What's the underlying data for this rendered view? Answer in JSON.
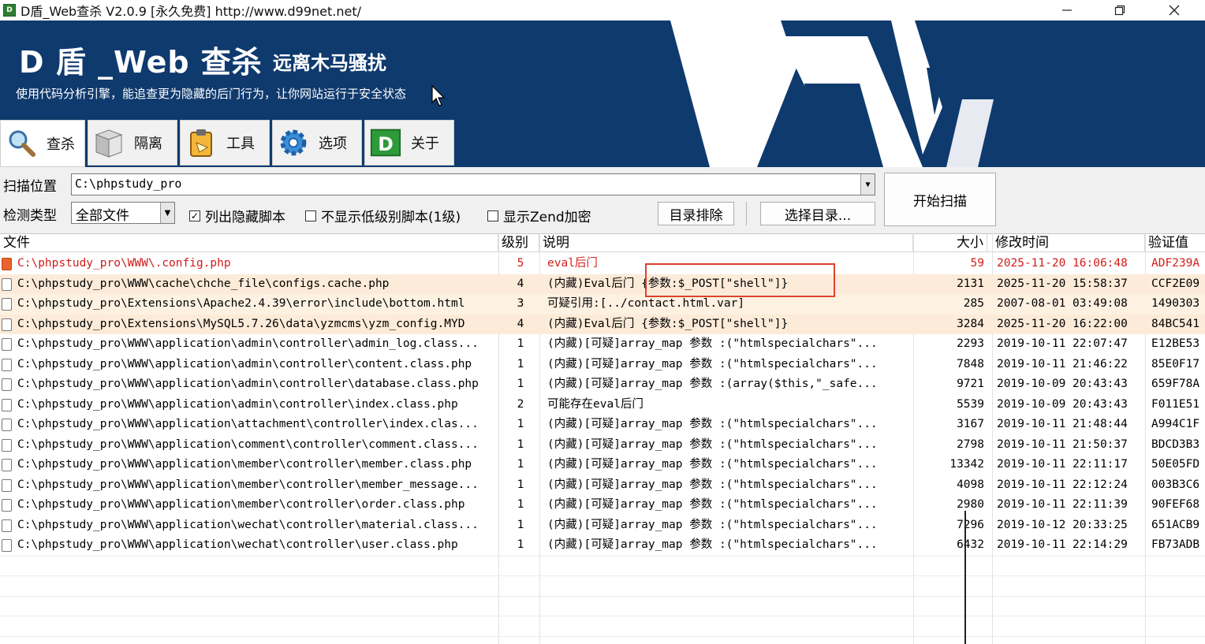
{
  "window": {
    "title": "D盾_Web查杀 V2.0.9 [永久免费] http://www.d99net.net/",
    "icon_label": "D",
    "controls": [
      "minimize-icon",
      "restore-icon",
      "close-icon"
    ]
  },
  "banner": {
    "title": "D 盾 _Web 查杀",
    "subtitle": "远离木马骚扰",
    "description": "使用代码分析引擎，能追查更为隐藏的后门行为，让你网站运行于安全状态",
    "background_color": "#0f3a6e"
  },
  "tabs": [
    {
      "label": "查杀",
      "icon": "magnifier-icon",
      "active": true
    },
    {
      "label": "隔离",
      "icon": "box-icon",
      "active": false
    },
    {
      "label": "工具",
      "icon": "clipboard-icon",
      "active": false
    },
    {
      "label": "选项",
      "icon": "gear-icon",
      "active": false
    },
    {
      "label": "关于",
      "icon": "d-logo-icon",
      "active": false
    }
  ],
  "controls": {
    "scan_location_label": "扫描位置",
    "scan_location_value": "C:\\phpstudy_pro",
    "detect_type_label": "检测类型",
    "detect_type_value": "全部文件",
    "show_hidden": {
      "label": "列出隐藏脚本",
      "checked": true
    },
    "hide_low_level": {
      "label": "不显示低级别脚本(1级)",
      "checked": false
    },
    "show_zend": {
      "label": "显示Zend加密",
      "checked": false
    },
    "exclude_dir_button": "目录排除",
    "select_dir_button": "选择目录...",
    "start_scan_button": "开始扫描"
  },
  "table": {
    "headers": {
      "file": "文件",
      "level": "级别",
      "desc": "说明",
      "size": "大小",
      "mtime": "修改时间",
      "hash": "验证值"
    },
    "rows": [
      {
        "file": "C:\\phpstudy_pro\\WWW\\.config.php",
        "level": "5",
        "desc": "eval后门",
        "size": "59",
        "mtime": "2025-11-20 16:06:48",
        "hash": "ADF239A",
        "style": "red"
      },
      {
        "file": "C:\\phpstudy_pro\\WWW\\cache\\chche_file\\configs.cache.php",
        "level": "4",
        "desc": "(内藏)Eval后门 {参数:$_POST[\"shell\"]}",
        "size": "2131",
        "mtime": "2025-11-20 15:58:37",
        "hash": "CCF2E09",
        "style": "hl"
      },
      {
        "file": "C:\\phpstudy_pro\\Extensions\\Apache2.4.39\\error\\include\\bottom.html",
        "level": "3",
        "desc": "可疑引用:[../contact.html.var]",
        "size": "285",
        "mtime": "2007-08-01 03:49:08",
        "hash": "1490303",
        "style": "sel"
      },
      {
        "file": "C:\\phpstudy_pro\\Extensions\\MySQL5.7.26\\data\\yzmcms\\yzm_config.MYD",
        "level": "4",
        "desc": "(内藏)Eval后门 {参数:$_POST[\"shell\"]}",
        "size": "3284",
        "mtime": "2025-11-20 16:22:00",
        "hash": "84BC541",
        "style": "hl"
      },
      {
        "file": "C:\\phpstudy_pro\\WWW\\application\\admin\\controller\\admin_log.class...",
        "level": "1",
        "desc": "(内藏)[可疑]array_map 参数 :(\"htmlspecialchars\"...",
        "size": "2293",
        "mtime": "2019-10-11 22:07:47",
        "hash": "E12BE53",
        "style": ""
      },
      {
        "file": "C:\\phpstudy_pro\\WWW\\application\\admin\\controller\\content.class.php",
        "level": "1",
        "desc": "(内藏)[可疑]array_map 参数 :(\"htmlspecialchars\"...",
        "size": "7848",
        "mtime": "2019-10-11 21:46:22",
        "hash": "85E0F17",
        "style": ""
      },
      {
        "file": "C:\\phpstudy_pro\\WWW\\application\\admin\\controller\\database.class.php",
        "level": "1",
        "desc": "(内藏)[可疑]array_map 参数 :(array($this,\"_safe...",
        "size": "9721",
        "mtime": "2019-10-09 20:43:43",
        "hash": "659F78A",
        "style": ""
      },
      {
        "file": "C:\\phpstudy_pro\\WWW\\application\\admin\\controller\\index.class.php",
        "level": "2",
        "desc": "可能存在eval后门",
        "size": "5539",
        "mtime": "2019-10-09 20:43:43",
        "hash": "F011E51",
        "style": ""
      },
      {
        "file": "C:\\phpstudy_pro\\WWW\\application\\attachment\\controller\\index.clas...",
        "level": "1",
        "desc": "(内藏)[可疑]array_map 参数 :(\"htmlspecialchars\"...",
        "size": "3167",
        "mtime": "2019-10-11 21:48:44",
        "hash": "A994C1F",
        "style": ""
      },
      {
        "file": "C:\\phpstudy_pro\\WWW\\application\\comment\\controller\\comment.class...",
        "level": "1",
        "desc": "(内藏)[可疑]array_map 参数 :(\"htmlspecialchars\"...",
        "size": "2798",
        "mtime": "2019-10-11 21:50:37",
        "hash": "BDCD3B3",
        "style": ""
      },
      {
        "file": "C:\\phpstudy_pro\\WWW\\application\\member\\controller\\member.class.php",
        "level": "1",
        "desc": "(内藏)[可疑]array_map 参数 :(\"htmlspecialchars\"...",
        "size": "13342",
        "mtime": "2019-10-11 22:11:17",
        "hash": "50E05FD",
        "style": ""
      },
      {
        "file": "C:\\phpstudy_pro\\WWW\\application\\member\\controller\\member_message...",
        "level": "1",
        "desc": "(内藏)[可疑]array_map 参数 :(\"htmlspecialchars\"...",
        "size": "4098",
        "mtime": "2019-10-11 22:12:24",
        "hash": "003B3C6",
        "style": ""
      },
      {
        "file": "C:\\phpstudy_pro\\WWW\\application\\member\\controller\\order.class.php",
        "level": "1",
        "desc": "(内藏)[可疑]array_map 参数 :(\"htmlspecialchars\"...",
        "size": "2980",
        "mtime": "2019-10-11 22:11:39",
        "hash": "90FEF68",
        "style": ""
      },
      {
        "file": "C:\\phpstudy_pro\\WWW\\application\\wechat\\controller\\material.class...",
        "level": "1",
        "desc": "(内藏)[可疑]array_map 参数 :(\"htmlspecialchars\"...",
        "size": "7296",
        "mtime": "2019-10-12 20:33:25",
        "hash": "651ACB9",
        "style": ""
      },
      {
        "file": "C:\\phpstudy_pro\\WWW\\application\\wechat\\controller\\user.class.php",
        "level": "1",
        "desc": "(内藏)[可疑]array_map 参数 :(\"htmlspecialchars\"...",
        "size": "6432",
        "mtime": "2019-10-11 22:14:29",
        "hash": "FB73ADB",
        "style": ""
      }
    ]
  },
  "colors": {
    "danger_text": "#d21c1c",
    "highlight_row": "#fdebd9",
    "annotation_box": "#e0412a"
  }
}
